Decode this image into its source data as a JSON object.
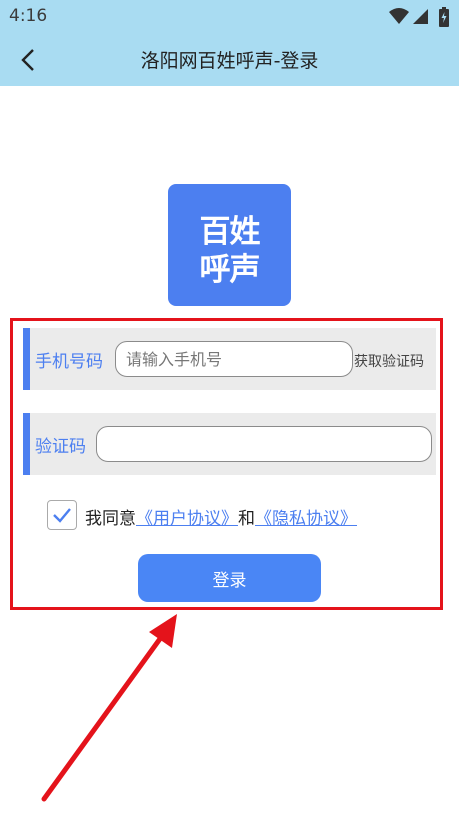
{
  "status_bar": {
    "time": "4:16",
    "icons": [
      "wifi-icon",
      "signal-icon",
      "battery-icon"
    ]
  },
  "header": {
    "title": "洛阳网百姓呼声-登录",
    "back_icon": "back-arrow-icon"
  },
  "logo": {
    "line1": "百姓",
    "line2": "呼声",
    "color": "#4c7ff0"
  },
  "form": {
    "phone_label": "手机号码",
    "phone_placeholder": "请输入手机号",
    "phone_value": "",
    "get_code_label": "获取验证码",
    "code_label": "验证码",
    "code_value": "",
    "agree_checked": true,
    "agree_prefix": "我同意",
    "user_agreement": "《用户协议》",
    "and_text": "和",
    "privacy_policy": "《隐私协议》",
    "login_label": "登录"
  },
  "colors": {
    "header_bg": "#a9dcf2",
    "accent": "#4c7ff0",
    "button": "#4a86f5",
    "highlight": "#e4131b",
    "row_bg": "#ebebeb"
  }
}
